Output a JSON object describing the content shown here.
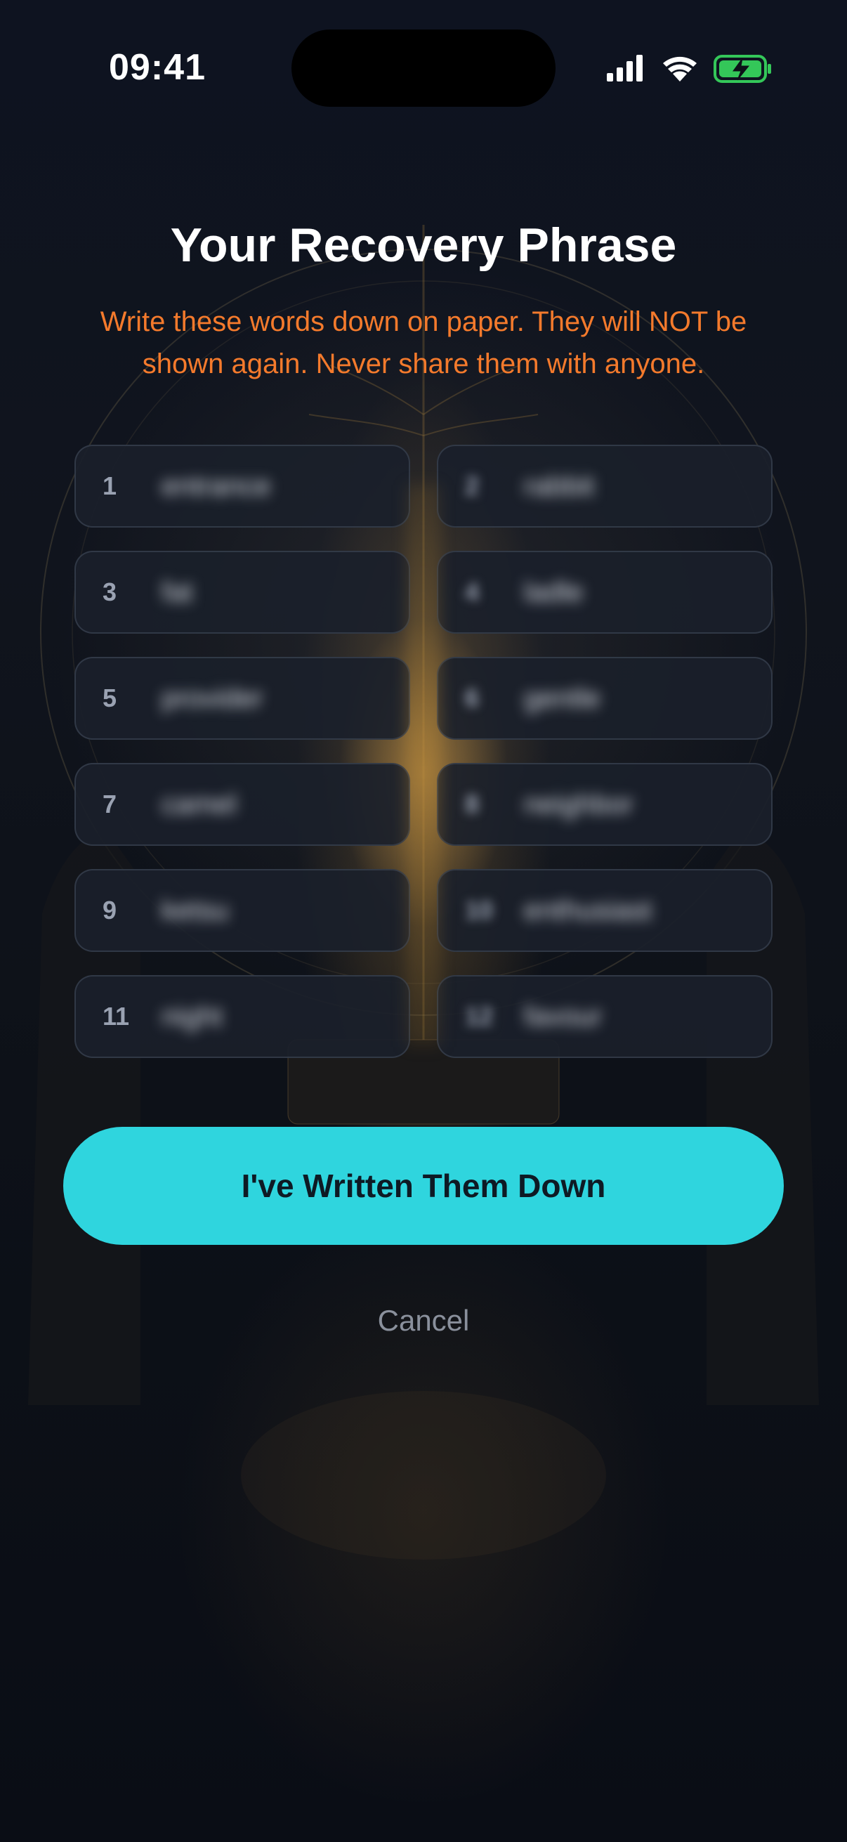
{
  "status_bar": {
    "time": "09:41",
    "icons": [
      "cellular-signal-icon",
      "wifi-icon",
      "battery-charging-icon"
    ],
    "battery_color": "#34c759"
  },
  "header": {
    "title": "Your Recovery Phrase",
    "warning": "Write these words down on paper. They will NOT be shown again. Never share them with anyone.",
    "warning_color": "#f47a2c"
  },
  "recovery_words": [
    {
      "number": "1",
      "word": "entrance"
    },
    {
      "number": "2",
      "word": "rabbit"
    },
    {
      "number": "3",
      "word": "fat"
    },
    {
      "number": "4",
      "word": "ladle"
    },
    {
      "number": "5",
      "word": "provider"
    },
    {
      "number": "6",
      "word": "gentle"
    },
    {
      "number": "7",
      "word": "camel"
    },
    {
      "number": "8",
      "word": "neighbor"
    },
    {
      "number": "9",
      "word": "ketsu"
    },
    {
      "number": "10",
      "word": "enthusiast"
    },
    {
      "number": "11",
      "word": "night"
    },
    {
      "number": "12",
      "word": "favour"
    }
  ],
  "actions": {
    "confirm_label": "I've Written Them Down",
    "confirm_color": "#2fd5de",
    "cancel_label": "Cancel"
  }
}
